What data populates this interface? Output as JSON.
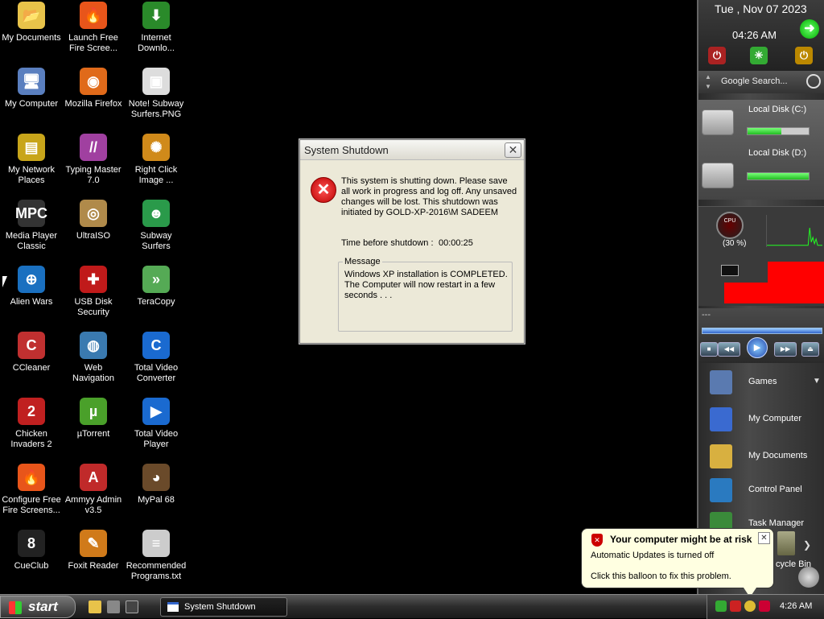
{
  "desktop_icons": [
    {
      "label": "My Documents",
      "glyph": "📂",
      "color": "#e8c34a"
    },
    {
      "label": "Launch Free\nFire Scree...",
      "glyph": "🔥",
      "color": "#e8551a"
    },
    {
      "label": "Internet\nDownlo...",
      "glyph": "⬇",
      "color": "#2a8a2a"
    },
    {
      "label": "My Computer",
      "glyph": "🖥",
      "color": "#5a7fbf"
    },
    {
      "label": "Mozilla Firefox",
      "glyph": "◉",
      "color": "#e06a1a"
    },
    {
      "label": "Note! Subway\nSurfers.PNG",
      "glyph": "▣",
      "color": "#ddd"
    },
    {
      "label": "My Network\nPlaces",
      "glyph": "▤",
      "color": "#c8a51a"
    },
    {
      "label": "Typing Master\n7.0",
      "glyph": "//",
      "color": "#a040a0"
    },
    {
      "label": "Right Click\nImage ...",
      "glyph": "✺",
      "color": "#d08a1a"
    },
    {
      "label": "Media Player\nClassic",
      "glyph": "MPC",
      "color": "#333"
    },
    {
      "label": "UltraISO",
      "glyph": "◎",
      "color": "#b08a4a"
    },
    {
      "label": "Subway\nSurfers",
      "glyph": "☻",
      "color": "#2a9a4a"
    },
    {
      "label": "Alien Wars",
      "glyph": "⊕",
      "color": "#1a70c0"
    },
    {
      "label": "USB Disk\nSecurity",
      "glyph": "✚",
      "color": "#c01a1a"
    },
    {
      "label": "TeraCopy",
      "glyph": "»",
      "color": "#5a5"
    },
    {
      "label": "CCleaner",
      "glyph": "C",
      "color": "#c03030"
    },
    {
      "label": "Web\nNavigation",
      "glyph": "◍",
      "color": "#3a7ab0"
    },
    {
      "label": "Total Video\nConverter",
      "glyph": "C",
      "color": "#1a6ad0"
    },
    {
      "label": "Chicken\nInvaders 2",
      "glyph": "2",
      "color": "#c02020"
    },
    {
      "label": "µTorrent",
      "glyph": "µ",
      "color": "#4aa02a"
    },
    {
      "label": "Total Video\nPlayer",
      "glyph": "▶",
      "color": "#1a6ad0"
    },
    {
      "label": "Configure Free\nFire Screens...",
      "glyph": "🔥",
      "color": "#e8551a"
    },
    {
      "label": "Ammyy Admin\nv3.5",
      "glyph": "A",
      "color": "#c02a2a"
    },
    {
      "label": "MyPal 68",
      "glyph": "◕",
      "color": "#6a4a2a"
    },
    {
      "label": "CueClub",
      "glyph": "8",
      "color": "#222"
    },
    {
      "label": "Foxit Reader",
      "glyph": "✎",
      "color": "#d07a1a"
    },
    {
      "label": "Recommended\nPrograms.txt",
      "glyph": "≡",
      "color": "#ccc"
    }
  ],
  "sidebar": {
    "date": "Tue , Nov 07 2023",
    "time": "04:26 AM",
    "search_placeholder": "Google Search...",
    "disk_c": {
      "label": "Local Disk (C:)",
      "fill": 0.55
    },
    "disk_d": {
      "label": "Local Disk (D:)",
      "fill": 1.0
    },
    "cpu_label": "CPU",
    "cpu_pct": "(30 %)",
    "media_title": "---",
    "launch_items": [
      {
        "label": "Games",
        "color": "#5a7ab0"
      },
      {
        "label": "My Computer",
        "color": "#3a6ad0"
      },
      {
        "label": "My Documents",
        "color": "#d8b040"
      },
      {
        "label": "Control Panel",
        "color": "#2a7ac0"
      },
      {
        "label": "Task Manager",
        "color": "#3a8a3a"
      }
    ],
    "recycle_partial": "cycle Bin"
  },
  "dialog": {
    "title": "System Shutdown",
    "message": "This system is shutting down. Please save all work in progress and log off. Any unsaved changes will be lost. This shutdown was initiated by GOLD-XP-2016\\M SADEEM",
    "time_label": "Time before shutdown :",
    "time_value": "00:00:25",
    "message_group_label": "Message",
    "message_group_text": "Windows XP installation is COMPLETED. The Computer will now restart in a few seconds . . ."
  },
  "balloon": {
    "title": "Your computer might be at risk",
    "line1": "Automatic Updates is turned off",
    "line2": "Click this balloon to fix this problem."
  },
  "taskbar": {
    "start_label": "start",
    "task_label": "System Shutdown",
    "clock": "4:26 AM"
  }
}
